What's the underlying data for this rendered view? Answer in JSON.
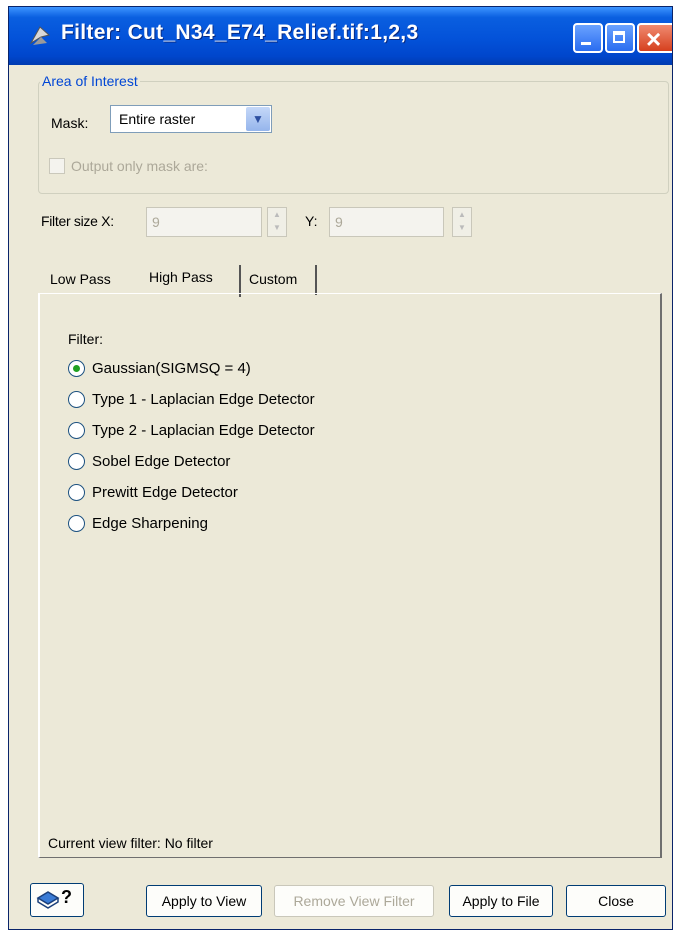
{
  "window": {
    "title": "Filter: Cut_N34_E74_Relief.tif:1,2,3",
    "controls": [
      "minimize",
      "maximize",
      "close"
    ]
  },
  "area_of_interest": {
    "legend": "Area of Interest",
    "mask_label": "Mask:",
    "mask_value": "Entire raster",
    "output_only_mask": {
      "label": "Output only mask are:",
      "checked": false,
      "enabled": false
    }
  },
  "filter_size": {
    "x_label": "Filter size X:",
    "x_value": "9",
    "y_label": "Y:",
    "y_value": "9",
    "enabled": false
  },
  "tabs": [
    {
      "label": "Low Pass",
      "active": false
    },
    {
      "label": "High Pass",
      "active": true
    },
    {
      "label": "Custom",
      "active": false
    }
  ],
  "high_pass": {
    "heading": "Filter:",
    "options": [
      {
        "label": "Gaussian(SIGMSQ = 4)",
        "selected": true
      },
      {
        "label": "Type 1 - Laplacian Edge Detector",
        "selected": false
      },
      {
        "label": "Type 2 - Laplacian Edge Detector",
        "selected": false
      },
      {
        "label": "Sobel Edge Detector",
        "selected": false
      },
      {
        "label": "Prewitt Edge Detector",
        "selected": false
      },
      {
        "label": "Edge Sharpening",
        "selected": false
      }
    ]
  },
  "status": {
    "text": "Current view filter:  No filter"
  },
  "buttons": {
    "help_label": "?",
    "apply_view": "Apply to View",
    "remove_view_filter": "Remove View Filter",
    "apply_file": "Apply to File",
    "close": "Close"
  },
  "colors": {
    "titlebar": "#0352d9",
    "window_bg": "#ece9d8",
    "legend_text": "#0046d5",
    "radio_dot": "#21a121"
  }
}
